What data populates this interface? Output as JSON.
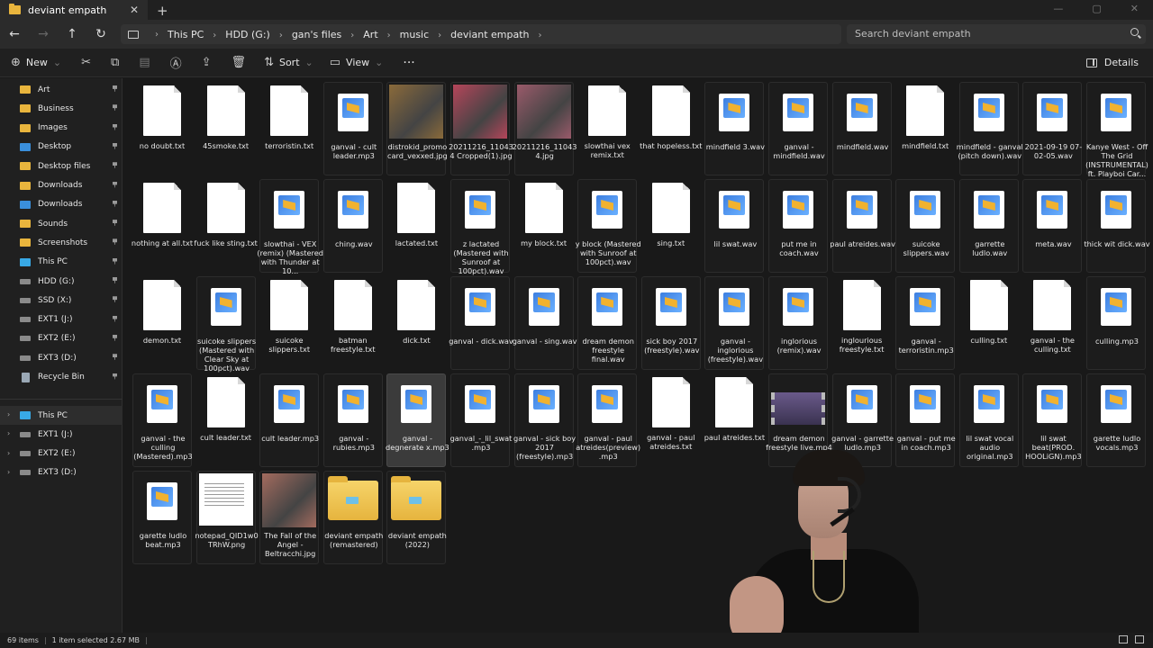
{
  "tab": {
    "title": "deviant empath"
  },
  "breadcrumbs": [
    "This PC",
    "HDD (G:)",
    "gan's files",
    "Art",
    "music",
    "deviant empath"
  ],
  "search": {
    "placeholder": "Search deviant empath"
  },
  "commands": {
    "new": "New",
    "sort": "Sort",
    "view": "View",
    "more": "···",
    "details": "Details"
  },
  "sidebar": {
    "pinned": [
      {
        "label": "Art",
        "icon": "folder"
      },
      {
        "label": "Business",
        "icon": "folder"
      },
      {
        "label": "Images",
        "icon": "folder"
      },
      {
        "label": "Desktop",
        "icon": "blue"
      },
      {
        "label": "Desktop files",
        "icon": "folder"
      },
      {
        "label": "Downloads",
        "icon": "folder"
      },
      {
        "label": "Downloads",
        "icon": "blue"
      },
      {
        "label": "Sounds",
        "icon": "folder"
      },
      {
        "label": "Screenshots",
        "icon": "folder"
      },
      {
        "label": "This PC",
        "icon": "pc"
      },
      {
        "label": "HDD (G:)",
        "icon": "drive"
      },
      {
        "label": "SSD (X:)",
        "icon": "drive"
      },
      {
        "label": "EXT1 (J:)",
        "icon": "drive"
      },
      {
        "label": "EXT2 (E:)",
        "icon": "drive"
      },
      {
        "label": "EXT3 (D:)",
        "icon": "drive"
      },
      {
        "label": "Recycle Bin",
        "icon": "bin"
      }
    ],
    "tree": [
      {
        "label": "This PC",
        "icon": "pc",
        "selected": true
      },
      {
        "label": "EXT1 (J:)",
        "icon": "drive"
      },
      {
        "label": "EXT2 (E:)",
        "icon": "drive"
      },
      {
        "label": "EXT3 (D:)",
        "icon": "drive"
      }
    ]
  },
  "files": [
    [
      {
        "name": "no doubt.txt",
        "type": "txt"
      },
      {
        "name": "45smoke.txt",
        "type": "txt"
      },
      {
        "name": "terroristin.txt",
        "type": "txt"
      },
      {
        "name": "ganval - cult leader.mp3",
        "type": "audio"
      },
      {
        "name": "distrokid_promo card_vexxed.jpg",
        "type": "img",
        "color": "#8a6a3a"
      },
      {
        "name": "20211216_110434 Cropped(1).jpg",
        "type": "img",
        "color": "#b5455a"
      },
      {
        "name": "20211216_110434.jpg",
        "type": "img",
        "color": "#9a5a6a"
      },
      {
        "name": "slowthai vex remix.txt",
        "type": "txt"
      },
      {
        "name": "that hopeless.txt",
        "type": "txt"
      },
      {
        "name": "mindfield 3.wav",
        "type": "audio"
      },
      {
        "name": "ganval - mindfield.wav",
        "type": "audio"
      },
      {
        "name": "mindfield.wav",
        "type": "audio"
      },
      {
        "name": "mindfield.txt",
        "type": "txt"
      },
      {
        "name": "mindfield - ganval (pitch down).wav",
        "type": "audio"
      },
      {
        "name": "2021-09-19 07-02-05.wav",
        "type": "audio"
      },
      {
        "name": "Kanye West - Off The Grid (INSTRUMENTAL) ft. Playboi Car...",
        "type": "audio"
      }
    ],
    [
      {
        "name": "nothing at all.txt",
        "type": "txt"
      },
      {
        "name": "fuck like sting.txt",
        "type": "txt"
      },
      {
        "name": "slowthai - VEX (remix) (Mastered with Thunder at 10...",
        "type": "audio"
      },
      {
        "name": "ching.wav",
        "type": "audio"
      },
      {
        "name": "lactated.txt",
        "type": "txt"
      },
      {
        "name": "z lactated (Mastered with Sunroof at 100pct).wav",
        "type": "audio"
      },
      {
        "name": "my block.txt",
        "type": "txt"
      },
      {
        "name": "y block (Mastered with Sunroof at 100pct).wav",
        "type": "audio"
      },
      {
        "name": "sing.txt",
        "type": "txt"
      },
      {
        "name": "lil swat.wav",
        "type": "audio"
      },
      {
        "name": "put me in coach.wav",
        "type": "audio"
      },
      {
        "name": "paul atreides.wav",
        "type": "audio"
      },
      {
        "name": "suicoke slippers.wav",
        "type": "audio"
      },
      {
        "name": "garrette ludlo.wav",
        "type": "audio"
      },
      {
        "name": "meta.wav",
        "type": "audio"
      },
      {
        "name": "thick wit dick.wav",
        "type": "audio"
      }
    ],
    [
      {
        "name": "demon.txt",
        "type": "txt"
      },
      {
        "name": "suicoke slippers (Mastered with Clear Sky at 100pct).wav",
        "type": "audio"
      },
      {
        "name": "suicoke slippers.txt",
        "type": "txt"
      },
      {
        "name": "batman freestyle.txt",
        "type": "txt"
      },
      {
        "name": "dick.txt",
        "type": "txt"
      },
      {
        "name": "ganval - dick.wav",
        "type": "audio"
      },
      {
        "name": "ganval - sing.wav",
        "type": "audio"
      },
      {
        "name": "dream demon freestyle final.wav",
        "type": "audio"
      },
      {
        "name": "sick boy 2017 (freestyle).wav",
        "type": "audio"
      },
      {
        "name": "ganval - inglorious (freestyle).wav",
        "type": "audio"
      },
      {
        "name": "inglorious (remix).wav",
        "type": "audio"
      },
      {
        "name": "inglourious freestyle.txt",
        "type": "txt"
      },
      {
        "name": "ganval - terroristin.mp3",
        "type": "audio"
      },
      {
        "name": "culling.txt",
        "type": "txt"
      },
      {
        "name": "ganval - the culling.txt",
        "type": "txt"
      },
      {
        "name": "culling.mp3",
        "type": "audio"
      }
    ],
    [
      {
        "name": "ganval - the culling (Mastered).mp3",
        "type": "audio"
      },
      {
        "name": "cult leader.txt",
        "type": "txt"
      },
      {
        "name": "cult leader.mp3",
        "type": "audio"
      },
      {
        "name": "ganval - rubies.mp3",
        "type": "audio"
      },
      {
        "name": "ganval - degnerate x.mp3",
        "type": "audio",
        "selected": true
      },
      {
        "name": "ganval_-_lil_swat .mp3",
        "type": "audio"
      },
      {
        "name": "ganval - sick boy 2017 (freestyle).mp3",
        "type": "audio"
      },
      {
        "name": "ganval - paul atreides(preview) .mp3",
        "type": "audio"
      },
      {
        "name": "ganval - paul atreides.txt",
        "type": "txt"
      },
      {
        "name": "paul atreides.txt",
        "type": "txt"
      },
      {
        "name": "dream demon freestyle live.mp4",
        "type": "vid"
      },
      {
        "name": "ganval - garrette ludlo.mp3",
        "type": "audio"
      },
      {
        "name": "ganval - put me in coach.mp3",
        "type": "audio"
      },
      {
        "name": "lil swat vocal audio original.mp3",
        "type": "audio"
      },
      {
        "name": "lil swat beat(PROD. HOOLiGN).mp3",
        "type": "audio"
      },
      {
        "name": "garette ludlo vocals.mp3",
        "type": "audio"
      }
    ],
    [
      {
        "name": "garette ludlo beat.mp3",
        "type": "audio"
      },
      {
        "name": "notepad_QID1w0 TRhW.png",
        "type": "png"
      },
      {
        "name": "The Fall of the Angel - Beltracchi.jpg",
        "type": "img",
        "color": "#a36b5e"
      },
      {
        "name": "deviant empath (remastered)",
        "type": "fold"
      },
      {
        "name": "deviant empath (2022)",
        "type": "fold"
      }
    ]
  ],
  "status": {
    "count": "69 items",
    "selected": "1 item selected  2.67 MB"
  }
}
